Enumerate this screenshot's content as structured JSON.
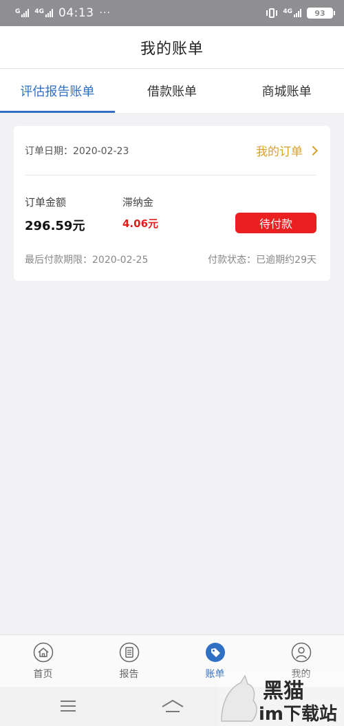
{
  "status_bar": {
    "carrier1": "G",
    "carrier2": "4G",
    "time": "04:13",
    "more": "···",
    "network": "4G",
    "battery": "93"
  },
  "header": {
    "title": "我的账单"
  },
  "tabs": [
    {
      "label": "评估报告账单",
      "active": true
    },
    {
      "label": "借款账单",
      "active": false
    },
    {
      "label": "商城账单",
      "active": false
    }
  ],
  "bill": {
    "order_date": "订单日期：2020-02-23",
    "my_orders": "我的订单",
    "amount_label": "订单金额",
    "amount_value": "296.59元",
    "late_fee_label": "滞纳金",
    "late_fee_value": "4.06元",
    "pay_button": "待付款",
    "deadline": "最后付款期限：2020-02-25",
    "status": "付款状态：已逾期约29天"
  },
  "bottom_nav": [
    {
      "label": "首页",
      "icon": "home-icon",
      "active": false
    },
    {
      "label": "报告",
      "icon": "report-icon",
      "active": false
    },
    {
      "label": "账单",
      "icon": "bill-tag-icon",
      "active": true
    },
    {
      "label": "我的",
      "icon": "user-icon",
      "active": false
    }
  ],
  "watermark": {
    "text_top": "黑猫",
    "text_bottom": "im下载站"
  },
  "colors": {
    "accent": "#2f6fc4",
    "warning": "#d9a12a",
    "danger": "#ea1f1f"
  }
}
